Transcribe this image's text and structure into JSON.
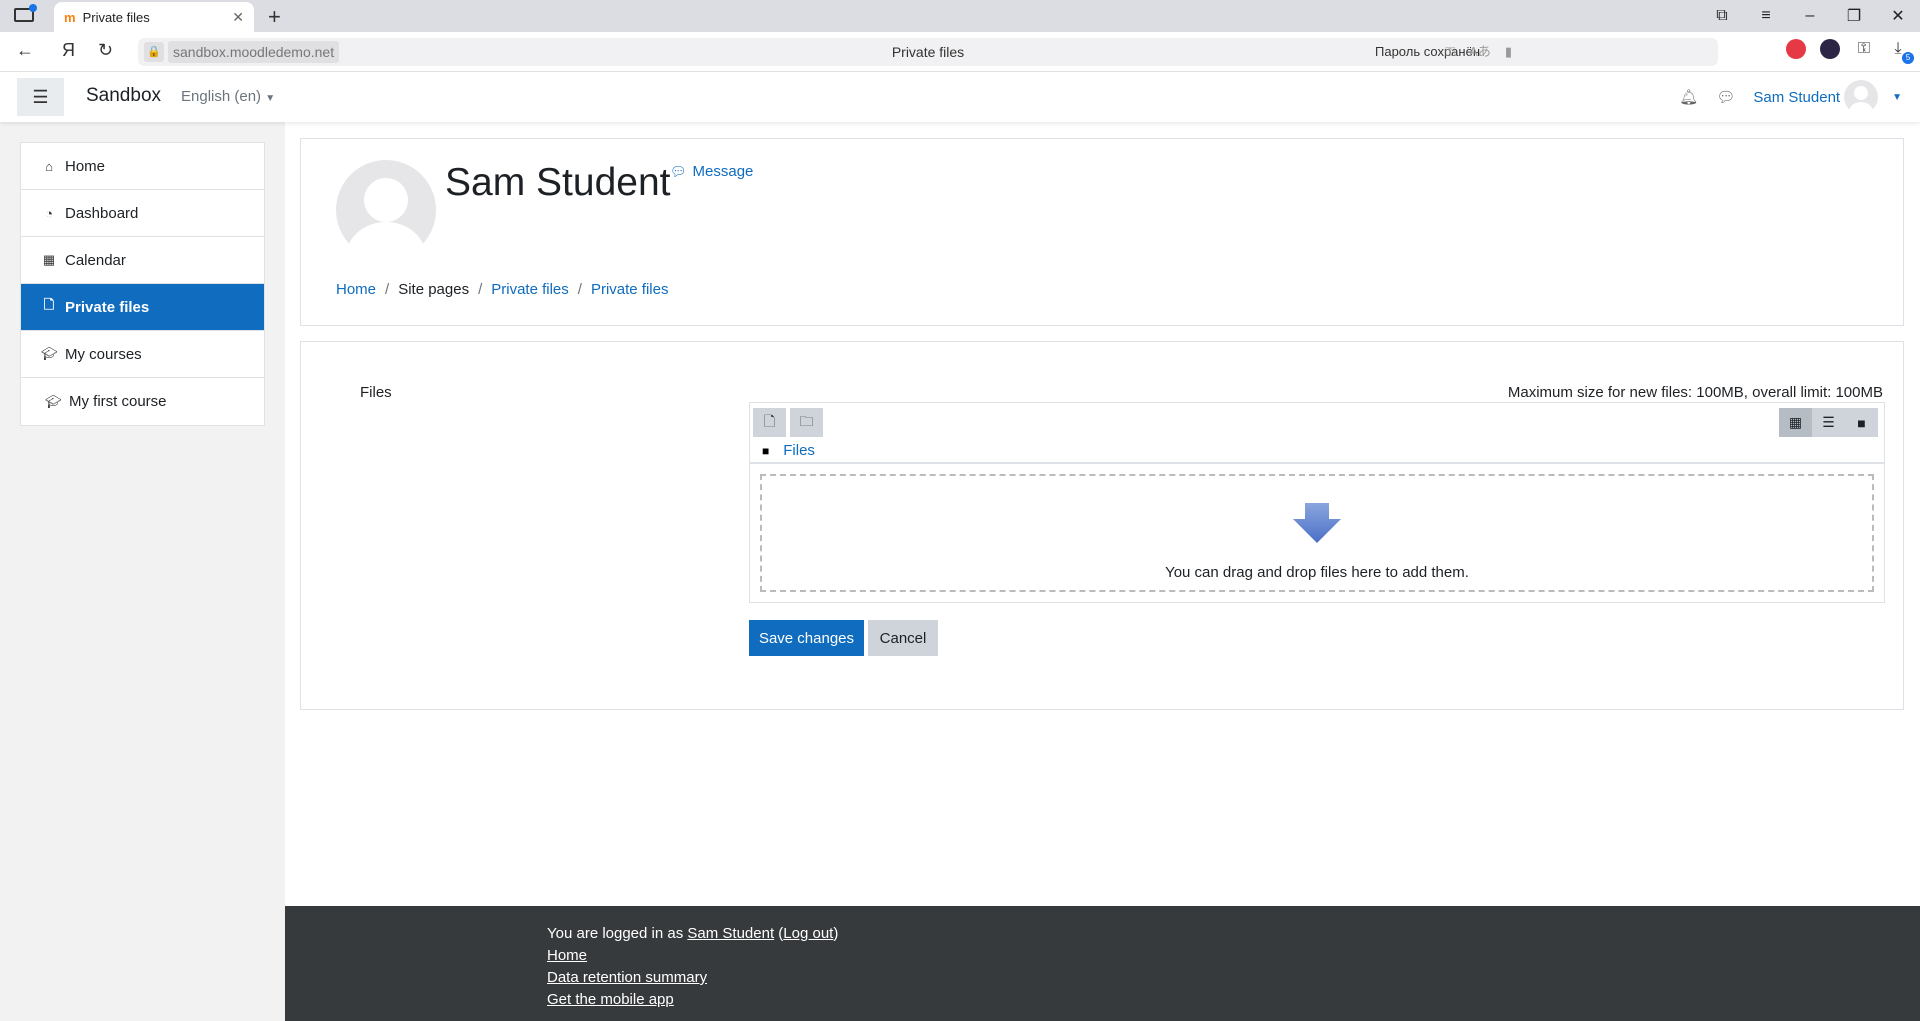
{
  "browser": {
    "tab_title": "Private files",
    "tab_favicon": "m",
    "url": "sandbox.moodledemo.net",
    "page_title": "Private files",
    "password_saved": "Пароль сохранён",
    "downloads_badge": "5"
  },
  "navbar": {
    "brand": "Sandbox",
    "language": "English (en)",
    "user_name": "Sam Student"
  },
  "drawer": {
    "items": [
      {
        "label": "Home",
        "icon": "home-icon"
      },
      {
        "label": "Dashboard",
        "icon": "dashboard-icon"
      },
      {
        "label": "Calendar",
        "icon": "calendar-icon"
      },
      {
        "label": "Private files",
        "icon": "file-icon",
        "active": true
      },
      {
        "label": "My courses",
        "icon": "graduation-cap-icon"
      },
      {
        "label": "My first course",
        "icon": "graduation-cap-icon"
      }
    ]
  },
  "header": {
    "name": "Sam Student",
    "message_label": "Message",
    "breadcrumb": [
      "Home",
      "Site pages",
      "Private files",
      "Private files"
    ]
  },
  "form": {
    "files_label": "Files",
    "max_size": "Maximum size for new files: 100MB, overall limit: 100MB",
    "path_label": "Files",
    "drop_text": "You can drag and drop files here to add them.",
    "save_label": "Save changes",
    "cancel_label": "Cancel"
  },
  "footer": {
    "logged_in_prefix": "You are logged in as ",
    "user_name": "Sam Student",
    "logout_label": "Log out",
    "links": [
      "Home",
      "Data retention summary",
      "Get the mobile app"
    ]
  },
  "colors": {
    "primary": "#0f6cbf",
    "footer_bg": "#373a3c",
    "drawer_bg": "#f2f2f2"
  }
}
